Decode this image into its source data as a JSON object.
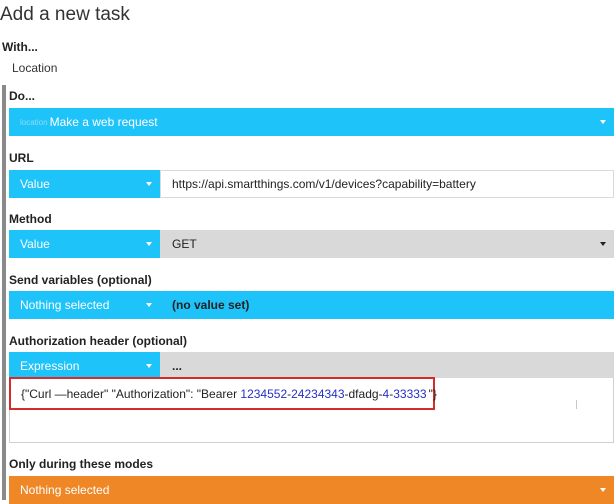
{
  "title": "Add a new task",
  "with": {
    "label": "With...",
    "value": "Location"
  },
  "do": {
    "label": "Do...",
    "select_prefix": "location",
    "select_value": "Make a web request"
  },
  "url": {
    "label": "URL",
    "type": "Value",
    "value": "https://api.smartthings.com/v1/devices?capability=battery"
  },
  "method": {
    "label": "Method",
    "type": "Value",
    "value": "GET"
  },
  "send_variables": {
    "label": "Send variables (optional)",
    "selected": "Nothing selected",
    "value": "(no value set)"
  },
  "auth": {
    "label": "Authorization header (optional)",
    "type": "Expression",
    "value": "...",
    "expr_part1": "{\"Curl —header\" \"Authorization\": \"Bearer ",
    "expr_num1": "1234552",
    "expr_dash1": "-",
    "expr_num2": "24234343",
    "expr_mid": "-dfadg-",
    "expr_num3": "4",
    "expr_dash2": "-",
    "expr_num4": "33333",
    "expr_end": "\"}"
  },
  "modes": {
    "label": "Only during these modes",
    "selected": "Nothing selected"
  },
  "colors": {
    "accent": "#1ec3fa",
    "orange": "#ef8727",
    "highlight": "#d62b2b"
  }
}
